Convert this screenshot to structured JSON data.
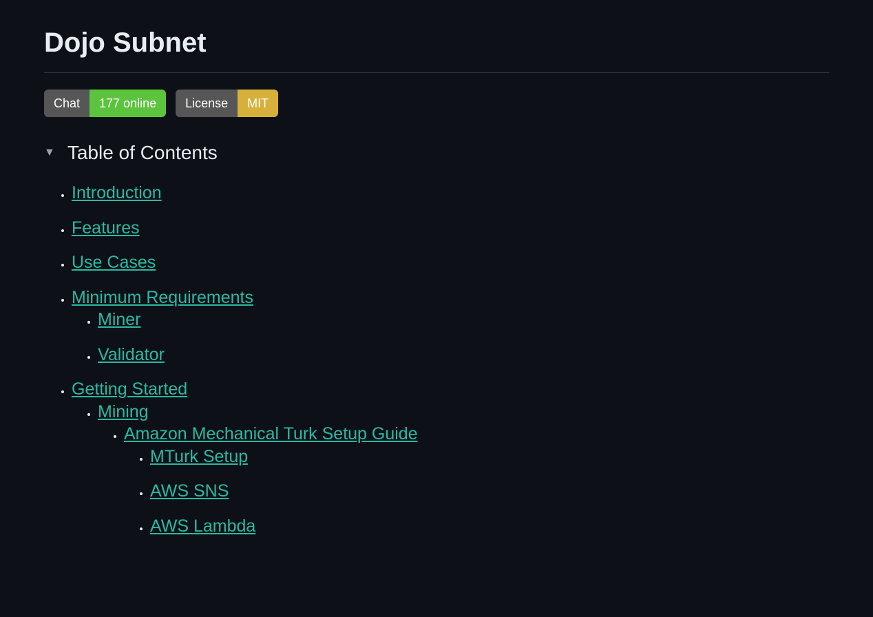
{
  "title": "Dojo Subnet",
  "badges": {
    "chat": {
      "label": "Chat",
      "value": "177 online"
    },
    "license": {
      "label": "License",
      "value": "MIT"
    }
  },
  "toc": {
    "heading": "Table of Contents",
    "items": {
      "intro": "Introduction",
      "features": "Features",
      "usecases": "Use Cases",
      "minreq": "Minimum Requirements",
      "miner": "Miner",
      "validator": "Validator",
      "getting": "Getting Started",
      "mining": "Mining",
      "mturk_guide": "Amazon Mechanical Turk Setup Guide",
      "mturk_setup": "MTurk Setup",
      "sns": "AWS SNS",
      "lambda": "AWS Lambda"
    }
  }
}
